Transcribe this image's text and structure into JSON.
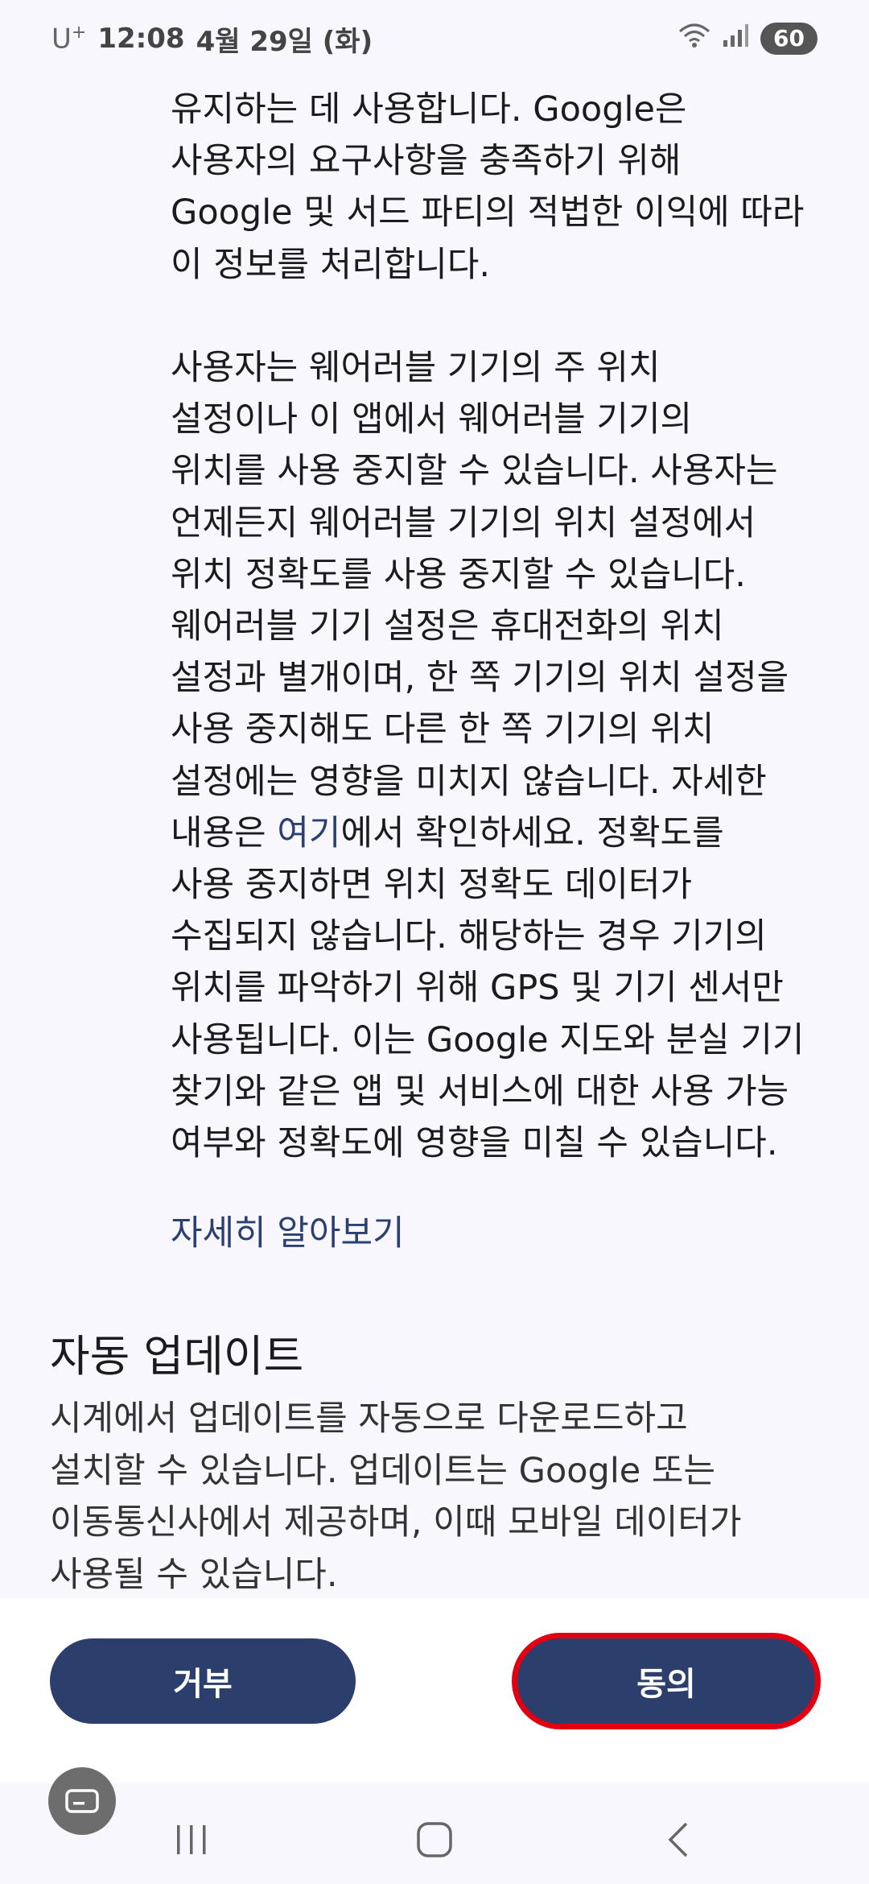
{
  "status": {
    "carrier": "U",
    "carrier_sup": "+",
    "time": "12:08",
    "date": "4월 29일 (화)",
    "battery": "60"
  },
  "top_paragraph": [
    "유지하는 데 사용합니다. Google은",
    "사용자의 요구사항을 충족하기 위해",
    "Google 및 서드 파티의 적법한 이익에 따라",
    "이 정보를 처리합니다."
  ],
  "location_paragraph": {
    "lines_before_link": [
      "사용자는 웨어러블 기기의 주 위치",
      "설정이나 이 앱에서 웨어러블 기기의",
      "위치를 사용 중지할 수 있습니다. 사용자는",
      "언제든지 웨어러블 기기의 위치 설정에서",
      "위치 정확도를 사용 중지할 수 있습니다.",
      "웨어러블 기기 설정은 휴대전화의 위치",
      "설정과 별개이며, 한 쪽 기기의 위치 설정을",
      "사용 중지해도 다른 한 쪽 기기의 위치",
      "설정에는 영향을 미치지 않습니다. 자세한"
    ],
    "link_line_prefix": "내용은 ",
    "link_text": "여기",
    "link_line_suffix": "에서 확인하세요. 정확도를",
    "lines_after_link": [
      "사용 중지하면 위치 정확도 데이터가",
      "수집되지 않습니다. 해당하는 경우 기기의",
      "위치를 파악하기 위해 GPS 및 기기 센서만",
      "사용됩니다. 이는 Google 지도와 분실 기기",
      "찾기와 같은 앱 및 서비스에 대한 사용 가능",
      "여부와 정확도에 영향을 미칠 수 있습니다."
    ]
  },
  "learn_more": "자세히 알아보기",
  "auto_update": {
    "title": "자동 업데이트",
    "body": [
      "시계에서 업데이트를 자동으로 다운로드하고",
      "설치할 수 있습니다. 업데이트는 Google 또는",
      "이동통신사에서 제공하며, 이때 모바일 데이터가",
      "사용될 수 있습니다."
    ]
  },
  "buttons": {
    "deny": "거부",
    "agree": "동의"
  },
  "icons": {
    "wifi": "wifi-icon",
    "signal": "signal-icon",
    "recents": "recents-icon",
    "home": "home-icon",
    "back": "back-icon",
    "keyboard": "keyboard-icon"
  },
  "colors": {
    "accent": "#2c3e6b",
    "link": "#2b3f73",
    "highlight": "#e00012"
  }
}
